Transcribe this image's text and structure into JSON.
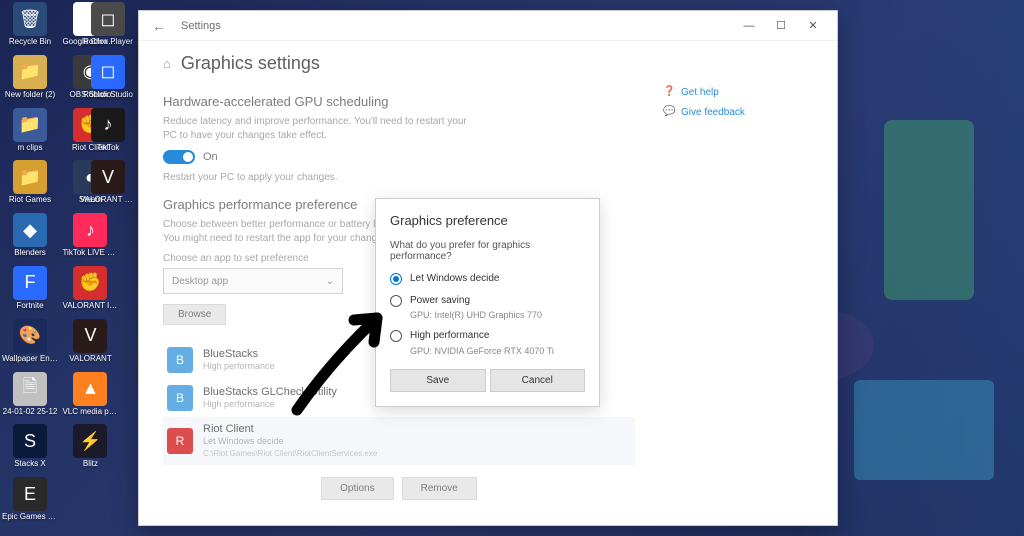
{
  "desktop_icons_col1": [
    {
      "label": "Recycle Bin",
      "bg": "#2a4a7a",
      "glyph": "🗑"
    },
    {
      "label": "New folder (2)",
      "bg": "#d8b050",
      "glyph": "📁"
    },
    {
      "label": "m clips",
      "bg": "#3a5a9a",
      "glyph": "📁"
    },
    {
      "label": "Riot Games",
      "bg": "#d6a030",
      "glyph": "📁"
    },
    {
      "label": "Blenders",
      "bg": "#2a6ab0",
      "glyph": "◆"
    },
    {
      "label": "Fortnite",
      "bg": "#2a6aff",
      "glyph": "F"
    },
    {
      "label": "Wallpaper Engine",
      "bg": "#1a2a5a",
      "glyph": "🎨"
    },
    {
      "label": "24-01-02 25-12",
      "bg": "#c0c0c0",
      "glyph": "🗎"
    },
    {
      "label": "Stacks X",
      "bg": "#0a1a3a",
      "glyph": "S"
    },
    {
      "label": "Epic Games Launcher",
      "bg": "#2a2a2a",
      "glyph": "E"
    }
  ],
  "desktop_icons_col2": [
    {
      "label": "Google Chrome",
      "bg": "#ffffff",
      "glyph": "⊙"
    },
    {
      "label": "OBS Studio",
      "bg": "#3a3a3a",
      "glyph": "◉"
    },
    {
      "label": "Riot Client",
      "bg": "#d62e2e",
      "glyph": "✊"
    },
    {
      "label": "Steam",
      "bg": "#2a3a5a",
      "glyph": "◐"
    },
    {
      "label": "TikTok LIVE Studio",
      "bg": "#ff2a5a",
      "glyph": "♪"
    },
    {
      "label": "VALORANT Influence...",
      "bg": "#d62e2e",
      "glyph": "✊"
    },
    {
      "label": "VALORANT",
      "bg": "#2a1a1a",
      "glyph": "V"
    },
    {
      "label": "VLC media player",
      "bg": "#ff8020",
      "glyph": "▲"
    },
    {
      "label": "Blitz",
      "bg": "#1a1a2a",
      "glyph": "⚡"
    }
  ],
  "desktop_icons_col3": [
    {
      "label": "Roblox Player",
      "bg": "#4a4a4a",
      "glyph": "◻"
    },
    {
      "label": "Roblox Studio",
      "bg": "#2a6aff",
      "glyph": "◻"
    },
    {
      "label": "TikTok",
      "bg": "#1a1a1a",
      "glyph": "♪"
    },
    {
      "label": "VALORANT PBE",
      "bg": "#2a1a1a",
      "glyph": "V"
    }
  ],
  "window": {
    "title": "Settings",
    "page_title": "Graphics settings",
    "sec1_h": "Hardware-accelerated GPU scheduling",
    "sec1_body": "Reduce latency and improve performance. You'll need to restart your PC to have your changes take effect.",
    "toggle_label": "On",
    "restart_note": "Restart your PC to apply your changes.",
    "sec2_h": "Graphics performance preference",
    "sec2_body": "Choose between better performance or battery life when using an app. You might need to restart the app for your changes to take effect.",
    "choose_label": "Choose an app to set preference",
    "select_value": "Desktop app",
    "browse": "Browse",
    "apps": [
      {
        "name": "BlueStacks",
        "pref": "High performance",
        "path": "",
        "bg": "#4aa0e0"
      },
      {
        "name": "BlueStacks GLCheck Utility",
        "pref": "High performance",
        "path": "",
        "bg": "#4aa0e0"
      },
      {
        "name": "Riot Client",
        "pref": "Let Windows decide",
        "path": "C:\\Riot Games\\Riot Client\\RiotClientServices.exe",
        "bg": "#d62e2e"
      }
    ],
    "options_btn": "Options",
    "remove_btn": "Remove",
    "help_link": "Get help",
    "feedback_link": "Give feedback"
  },
  "dialog": {
    "title": "Graphics preference",
    "question": "What do you prefer for graphics performance?",
    "opts": [
      {
        "label": "Let Windows decide",
        "sub": "",
        "checked": true
      },
      {
        "label": "Power saving",
        "sub": "GPU: Intel(R) UHD Graphics 770",
        "checked": false
      },
      {
        "label": "High performance",
        "sub": "GPU: NVIDIA GeForce RTX 4070 Ti",
        "checked": false
      }
    ],
    "save": "Save",
    "cancel": "Cancel"
  }
}
